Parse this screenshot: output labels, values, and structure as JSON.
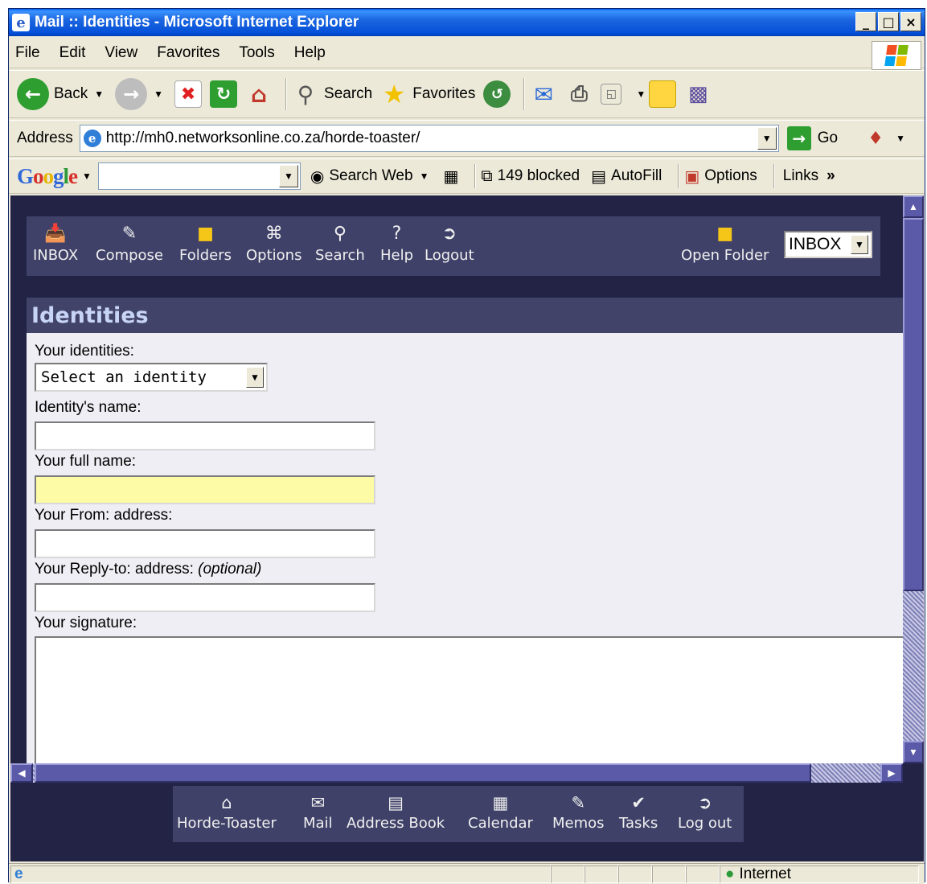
{
  "window": {
    "title": "Mail :: Identities - Microsoft Internet Explorer",
    "controls": [
      "_",
      "□",
      "×"
    ]
  },
  "menubar": [
    "File",
    "Edit",
    "View",
    "Favorites",
    "Tools",
    "Help"
  ],
  "toolbar": {
    "back": "Back",
    "search": "Search",
    "favorites": "Favorites"
  },
  "address": {
    "label": "Address",
    "url": "http://mh0.networksonline.co.za/horde-toaster/",
    "go": "Go"
  },
  "googlebar": {
    "logo": "Google",
    "search_web": "Search Web",
    "blocked": "149 blocked",
    "autofill": "AutoFill",
    "options": "Options",
    "links": "Links"
  },
  "horde_menu": {
    "items": [
      "INBOX",
      "Compose",
      "Folders",
      "Options",
      "Search",
      "Help",
      "Logout"
    ],
    "open_folder": "Open Folder",
    "folder_select": "INBOX"
  },
  "identities": {
    "header": "Identities",
    "your_identities_label": "Your identities:",
    "identity_select": "Select an identity",
    "identity_name_label": "Identity's name:",
    "full_name_label": "Your full name:",
    "from_label": "Your From: address:",
    "reply_to_label": "Your Reply-to: address:",
    "reply_to_optional": "(optional)",
    "signature_label": "Your signature:"
  },
  "footer_nav": [
    "Horde-Toaster",
    "Mail",
    "Address Book",
    "Calendar",
    "Memos",
    "Tasks",
    "Log out"
  ],
  "status": {
    "zone": "Internet"
  },
  "colors": {
    "page_bg": "#232346",
    "menu_bg": "#3f4168",
    "form_bg": "#efeef4",
    "highlight_field": "#fdfba5"
  }
}
